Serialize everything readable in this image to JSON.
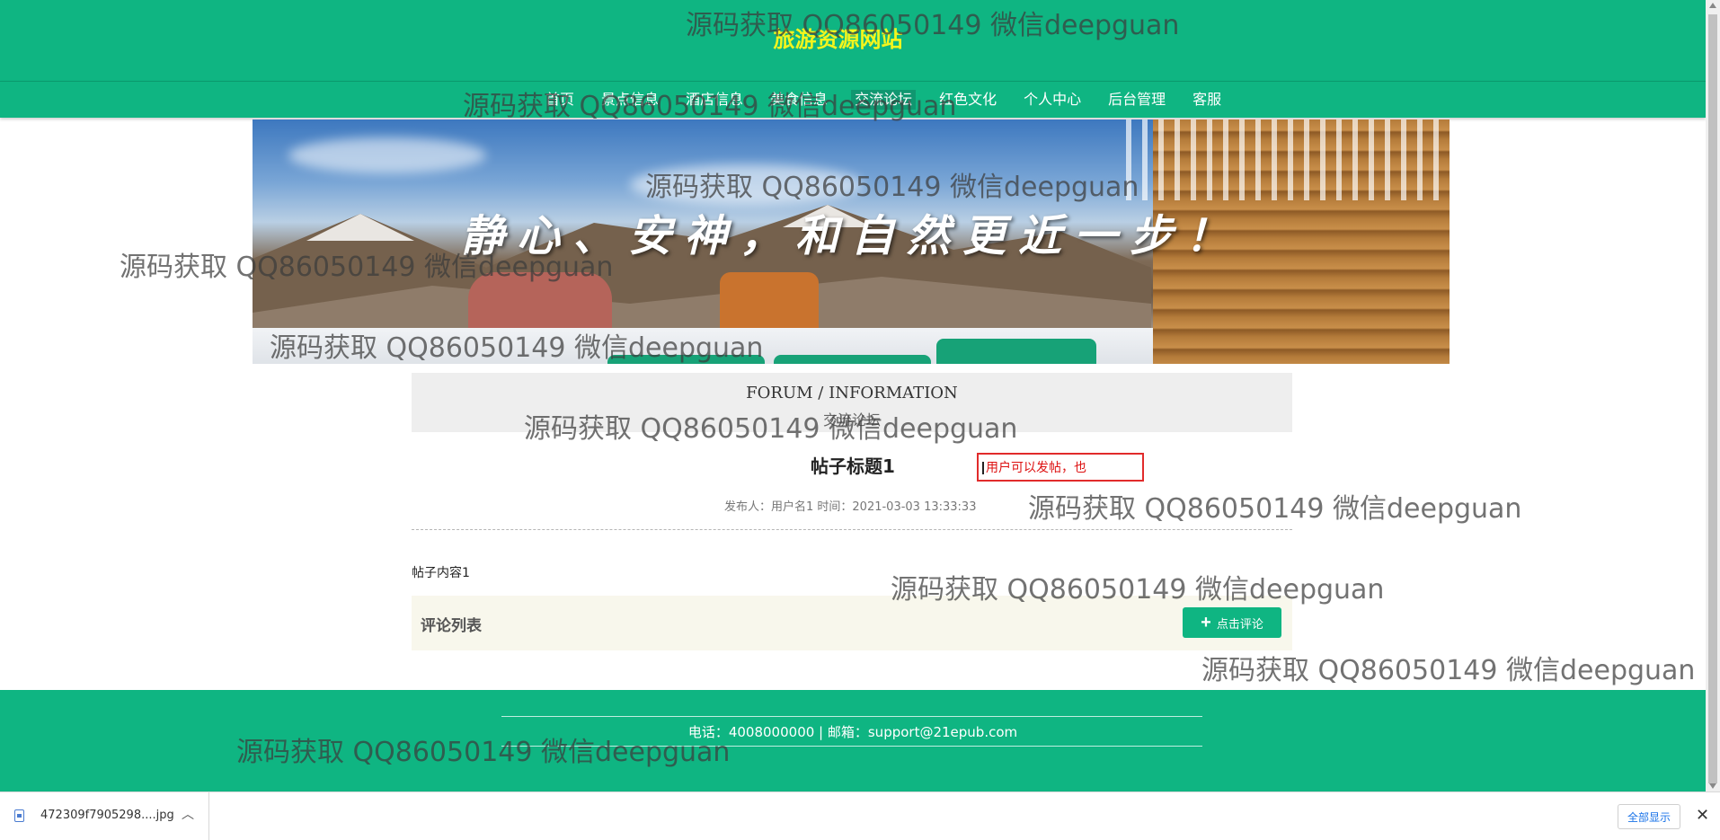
{
  "header": {
    "site_title": "旅游资源网站",
    "nav": [
      {
        "label": "首页",
        "active": false
      },
      {
        "label": "景点信息",
        "active": false
      },
      {
        "label": "酒店信息",
        "active": false
      },
      {
        "label": "美食信息",
        "active": false
      },
      {
        "label": "交流论坛",
        "active": true
      },
      {
        "label": "红色文化",
        "active": false
      },
      {
        "label": "个人中心",
        "active": false
      },
      {
        "label": "后台管理",
        "active": false
      },
      {
        "label": "客服",
        "active": false
      }
    ]
  },
  "banner": {
    "slogan": "静心、安神，和自然更近一步！"
  },
  "forum": {
    "section_en": "FORUM / INFORMATION",
    "section_cn": "交流论坛",
    "post_title": "帖子标题1",
    "post_meta": "发布人：用户名1 时间：2021-03-03 13:33:33",
    "hint_text": "用户可以发帖，也",
    "post_content": "帖子内容1",
    "comments_label": "评论列表",
    "comment_button": "点击评论"
  },
  "footer": {
    "contact": "电话：4008000000 | 邮箱：support@21epub.com"
  },
  "download_bar": {
    "file_name": "472309f7905298....jpg",
    "show_all": "全部显示"
  },
  "watermark_text": "源码获取 QQ86050149 微信deepguan",
  "colors": {
    "brand_green": "#0fb582",
    "title_yellow": "#f4f51d",
    "hint_red": "#e12b2b"
  },
  "icons": [
    "file-icon",
    "chevron-up-icon",
    "close-icon",
    "plus-icon"
  ]
}
